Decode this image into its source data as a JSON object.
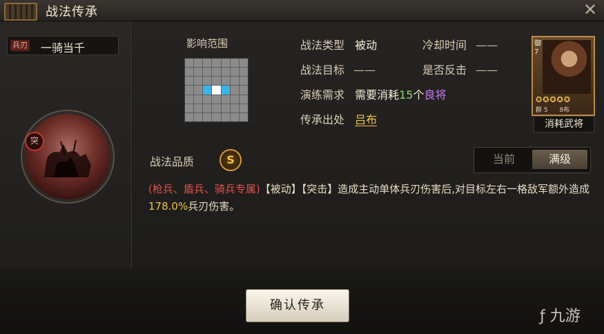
{
  "window": {
    "title": "战法传承",
    "close_icon": "close-icon"
  },
  "skill": {
    "type_tag": "兵刃",
    "name": "一骑当千",
    "emblem_badge": "突"
  },
  "range": {
    "label": "影响范围"
  },
  "info": {
    "type_label": "战法类型",
    "type_value": "被动",
    "cooldown_label": "冷却时间",
    "cooldown_value": "——",
    "target_label": "战法目标",
    "target_value": "——",
    "counter_label": "是否反击",
    "counter_value": "——",
    "req_label": "演练需求",
    "req_prefix": "需要消耗",
    "req_count": "15",
    "req_unit": "个",
    "req_item": "良将",
    "origin_label": "传承出处",
    "origin_value": "吕布"
  },
  "card": {
    "side_text": "御 7",
    "bottom_left": "群 5",
    "bottom_right": "8布",
    "consume_label": "消耗武将"
  },
  "quality": {
    "label": "战法品质",
    "grade": "S"
  },
  "tabs": {
    "current": "当前",
    "max": "满级"
  },
  "description": {
    "troops": "(枪兵、盾兵、骑兵专属)",
    "tag1": "【被动】",
    "tag2": "【突击】",
    "text1": "造成主动单体兵刃伤害后,对目标左右一格敌军额外造成",
    "value": "178.0%",
    "text2": "兵刃伤害。"
  },
  "footer": {
    "confirm": "确认传承",
    "watermark": "九游"
  },
  "colors": {
    "accent_gold": "#f0c24a",
    "accent_red": "#e0504a",
    "accent_purple": "#c97bf3"
  }
}
